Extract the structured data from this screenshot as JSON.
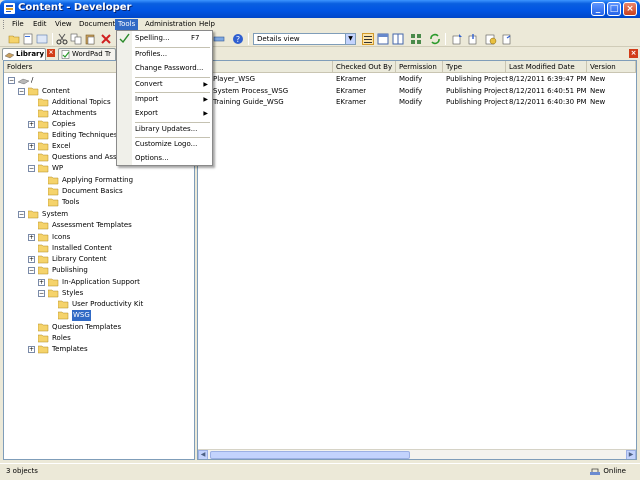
{
  "window": {
    "title": "Content - Developer"
  },
  "menubar": {
    "items": [
      "File",
      "Edit",
      "View",
      "Document",
      "Tools",
      "Administration",
      "Help"
    ]
  },
  "toolbar": {
    "view_select": "Details view"
  },
  "tabs": {
    "library": "Library",
    "wordpad": "WordPad Tr"
  },
  "folders_pane": {
    "header": "Folders"
  },
  "tree": {
    "root": "/",
    "content": "Content",
    "additional_topics": "Additional Topics",
    "attachments": "Attachments",
    "copies": "Copies",
    "editing_techniques": "Editing Techniques",
    "excel": "Excel",
    "questions": "Questions and Assess",
    "wp": "WP",
    "applying_formatting": "Applying Formatting",
    "document_basics": "Document Basics",
    "tools": "Tools",
    "system": "System",
    "assessment_templates": "Assessment Templates",
    "icons": "Icons",
    "installed_content": "Installed Content",
    "library_content": "Library Content",
    "publishing": "Publishing",
    "in_app_support": "In-Application Support",
    "styles": "Styles",
    "user_productivity_kit": "User Productivity Kit",
    "wsg": "WSG",
    "question_templates": "Question Templates",
    "roles": "Roles",
    "templates": "Templates"
  },
  "table": {
    "headers": [
      "",
      "Checked Out By",
      "Permission",
      "Type",
      "Last Modified Date",
      "Version"
    ],
    "rows": [
      [
        "Player_WSG",
        "EKramer",
        "Modify",
        "Publishing Project",
        "8/12/2011 6:39:47 PM",
        "New"
      ],
      [
        "System Process_WSG",
        "EKramer",
        "Modify",
        "Publishing Project",
        "8/12/2011 6:40:51 PM",
        "New"
      ],
      [
        "Training Guide_WSG",
        "EKramer",
        "Modify",
        "Publishing Project",
        "8/12/2011 6:40:30 PM",
        "New"
      ]
    ]
  },
  "tools_menu": {
    "spelling": "Spelling...",
    "spelling_shortcut": "F7",
    "profiles": "Profiles...",
    "change_password": "Change Password...",
    "convert": "Convert",
    "import": "Import",
    "export": "Export",
    "library_updates": "Library Updates...",
    "customize_logo": "Customize Logo...",
    "options": "Options..."
  },
  "statusbar": {
    "objects": "3 objects",
    "online": "Online"
  },
  "colors": {
    "selection": "#316ac5",
    "titlebar": "#0054e3",
    "folder": "#f5d36b"
  }
}
